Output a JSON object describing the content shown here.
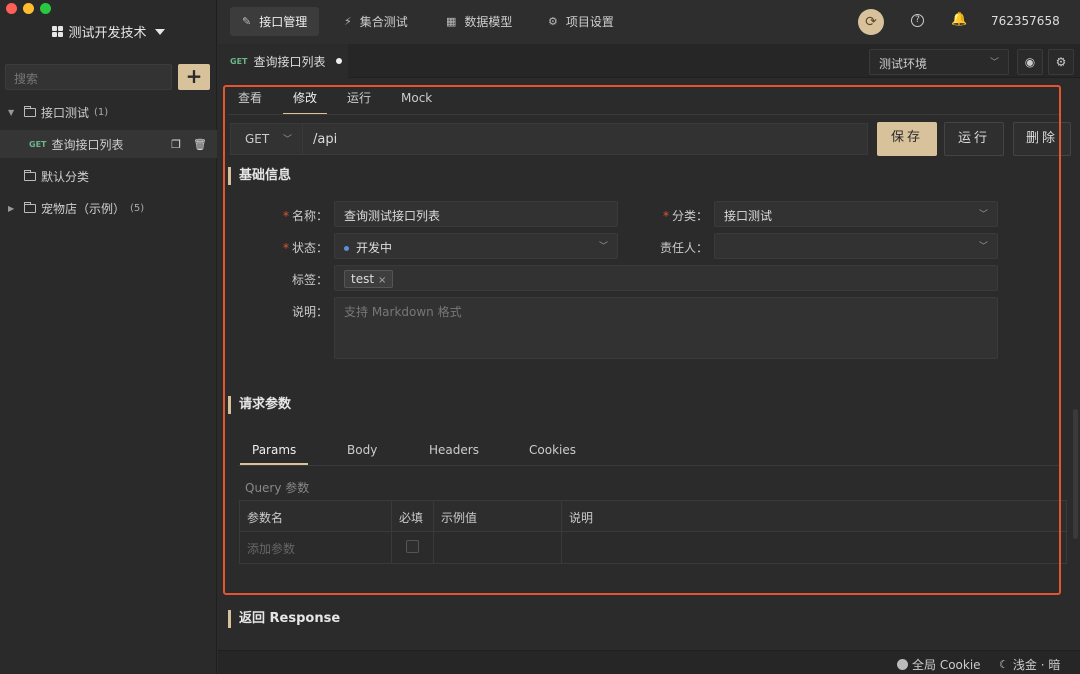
{
  "sidebar": {
    "project_name": "测试开发技术",
    "search_placeholder": "搜索",
    "add_label": "+",
    "tree": [
      {
        "label": "接口测试",
        "count": "(1)"
      },
      {
        "method": "GET",
        "label": "查询接口列表"
      },
      {
        "label": "默认分类"
      },
      {
        "label": "宠物店（示例）",
        "count": "(5)"
      }
    ]
  },
  "header": {
    "tabs": [
      {
        "label": "接口管理",
        "icon": "✎"
      },
      {
        "label": "集合测试",
        "icon": "⚡"
      },
      {
        "label": "数据模型",
        "icon": "▦"
      },
      {
        "label": "项目设置",
        "icon": "⚙"
      }
    ],
    "user_id": "762357658"
  },
  "doc_tab": {
    "method": "GET",
    "title": "查询接口列表"
  },
  "environment": "测试环境",
  "sub_tabs": [
    "查看",
    "修改",
    "运行",
    "Mock"
  ],
  "request": {
    "method": "GET",
    "url": "/api",
    "save": "保存",
    "run": "运行",
    "delete": "删除"
  },
  "basic_info": {
    "title": "基础信息",
    "name_label": "名称：",
    "name_value": "查询测试接口列表",
    "category_label": "分类：",
    "category_value": "接口测试",
    "status_label": "状态：",
    "status_value": "开发中",
    "owner_label": "责任人：",
    "owner_value": "",
    "tags_label": "标签：",
    "tag": "test",
    "desc_label": "说明：",
    "desc_placeholder": "支持 Markdown 格式"
  },
  "params": {
    "title": "请求参数",
    "tabs": [
      "Params",
      "Body",
      "Headers",
      "Cookies"
    ],
    "query_label": "Query 参数",
    "columns": [
      "参数名",
      "必填",
      "示例值",
      "说明"
    ],
    "add_placeholder": "添加参数"
  },
  "response": {
    "title": "返回 Response"
  },
  "footer": {
    "cookie": "全局 Cookie",
    "theme": "浅金 · 暗"
  },
  "colors": {
    "accent": "#d8c29c",
    "highlight": "#e2552e",
    "get": "#6cb58b"
  }
}
